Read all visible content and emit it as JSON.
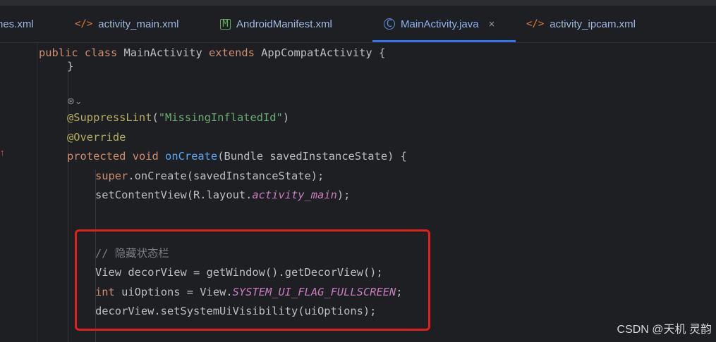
{
  "tabs": [
    {
      "label": "nes.xml",
      "icon": "none"
    },
    {
      "label": "activity_main.xml",
      "icon": "xml-icon"
    },
    {
      "label": "AndroidManifest.xml",
      "icon": "manifest-icon"
    },
    {
      "label": "MainActivity.java",
      "icon": "java-class-icon",
      "active": true
    },
    {
      "label": "activity_ipcam.xml",
      "icon": "xml-icon"
    }
  ],
  "glyphs": {
    "xml": "</>",
    "manifest": "M",
    "class": "C",
    "close": "×",
    "override_gutter": "↑",
    "inlay_hint": "⊛⌄"
  },
  "code": {
    "l1_kw1": "public",
    "l1_kw2": "class",
    "l1_name": "MainActivity",
    "l1_kw3": "extends",
    "l1_rest": "AppCompatActivity {",
    "l2": "}",
    "l4_ann": "@SuppressLint",
    "l4_open": "(",
    "l4_str": "\"MissingInflatedId\"",
    "l4_close": ")",
    "l5_ann": "@Override",
    "l6_kw1": "protected",
    "l6_kw2": "void",
    "l6_fn": "onCreate",
    "l6_rest": "(Bundle savedInstanceState) {",
    "l7_kw": "super",
    "l7_rest": ".onCreate(savedInstanceState);",
    "l8_pre": "setContentView(R.layout.",
    "l8_stat": "activity_main",
    "l8_post": ");",
    "l10_cmt": "// 隐藏状态栏",
    "l11": "View decorView = getWindow().getDecorView();",
    "l12_kw": "int",
    "l12_mid": "uiOptions = View.",
    "l12_stat": "SYSTEM_UI_FLAG_FULLSCREEN",
    "l12_end": ";",
    "l13": "decorView.setSystemUiVisibility(uiOptions);"
  },
  "watermark": "CSDN @天机 灵韵",
  "colors": {
    "highlight_box": "#e0211b",
    "tab_underline": "#3574f0",
    "keyword": "#cf8e6d",
    "string": "#6aab73",
    "annotation": "#b3ae60",
    "function": "#56a8f5",
    "static_field": "#c77dbb"
  }
}
